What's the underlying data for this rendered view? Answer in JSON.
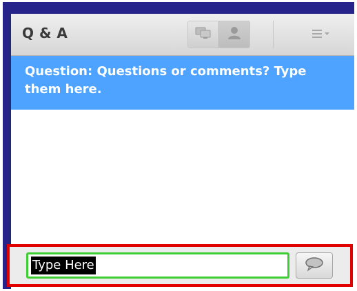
{
  "pod": {
    "title": "Q & A",
    "question_text": "Question: Questions or comments? Type them here.",
    "input_value": "Type Here"
  },
  "icons": {
    "view_toggle_presenter": "presenter-view-icon",
    "view_toggle_participant": "participant-view-icon",
    "menu": "pod-options-menu-icon",
    "send": "speech-bubble-icon"
  },
  "colors": {
    "frame": "#26248a",
    "question_highlight": "#4da3ff",
    "callout_border": "#e00000",
    "input_focus_border": "#3fcd34"
  }
}
